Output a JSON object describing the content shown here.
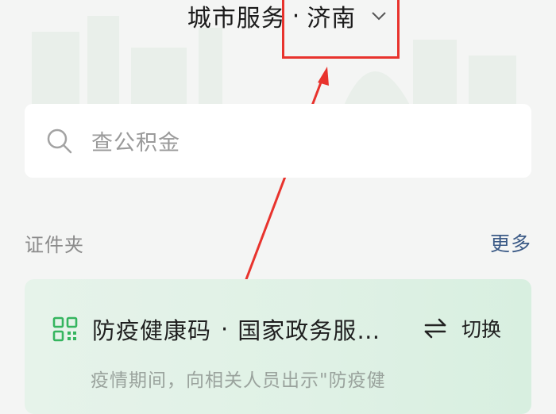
{
  "header": {
    "title": "城市服务",
    "separator": "·",
    "city": "济南"
  },
  "search": {
    "placeholder": "查公积金"
  },
  "section": {
    "label": "证件夹",
    "more": "更多"
  },
  "card": {
    "title": "防疫健康码",
    "separator": "·",
    "source": "国家政务服…",
    "switch_label": "切换",
    "description": "疫情期间，向相关人员出示\"防疫健"
  },
  "colors": {
    "annotation": "#e8332d",
    "accent_green": "#35b55f",
    "link_blue": "#3b5a86",
    "card_bg": "#e3f2e8"
  },
  "icons": {
    "city_chevron": "chevron-down-icon",
    "search": "search-icon",
    "card": "qr-code-icon",
    "switch": "swap-arrows-icon"
  }
}
